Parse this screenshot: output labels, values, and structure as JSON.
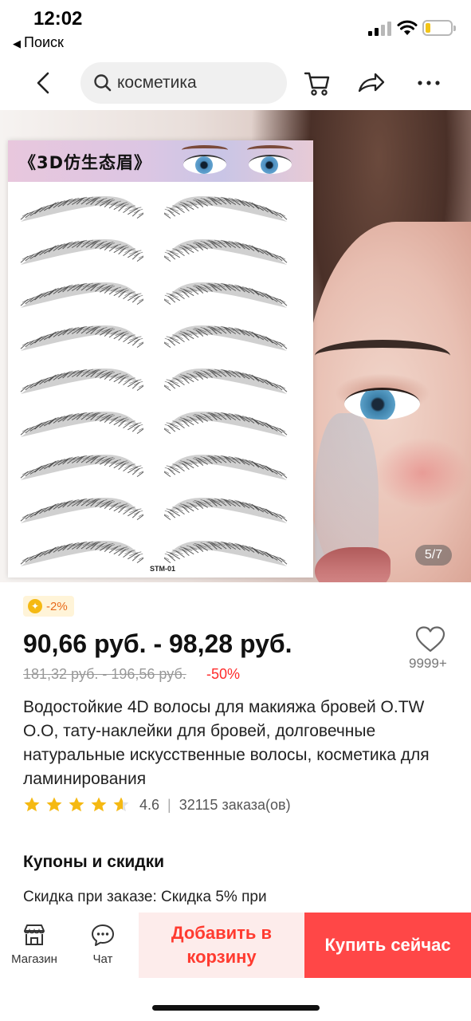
{
  "status_bar": {
    "time": "12:02",
    "back_app_label": "Поиск"
  },
  "nav": {
    "search_value": "косметика",
    "icons": [
      "back-arrow",
      "search",
      "cart",
      "share",
      "more"
    ]
  },
  "gallery": {
    "image_title": "《3D仿生态眉》",
    "image_code": "STM-01",
    "counter": "5/7"
  },
  "price": {
    "coin_discount": "-2%",
    "current": "90,66 руб. - 98,28 руб.",
    "original": "181,32 руб. - 196,56 руб.",
    "discount": "-50%"
  },
  "wishlist": {
    "count": "9999+"
  },
  "product": {
    "title": "Водостойкие 4D волосы для макияжа бровей O.TW O.O, тату-наклейки для бровей, долговечные натуральные искусственные волосы, косметика для ламинирования",
    "rating": "4.6",
    "rating_stars": 4.6,
    "orders": "32115 заказа(ов)"
  },
  "coupons": {
    "heading": "Купоны и скидки",
    "line": "Скидка при заказе: Скидка 5% при"
  },
  "bottom_bar": {
    "store_label": "Магазин",
    "chat_label": "Чат",
    "add_to_cart": "Добавить в корзину",
    "buy_now": "Купить сейчас"
  },
  "colors": {
    "accent_red": "#ff4747",
    "cart_bg": "#fdeceb",
    "star": "#f5b913",
    "discount_red": "#ff2b2b"
  }
}
